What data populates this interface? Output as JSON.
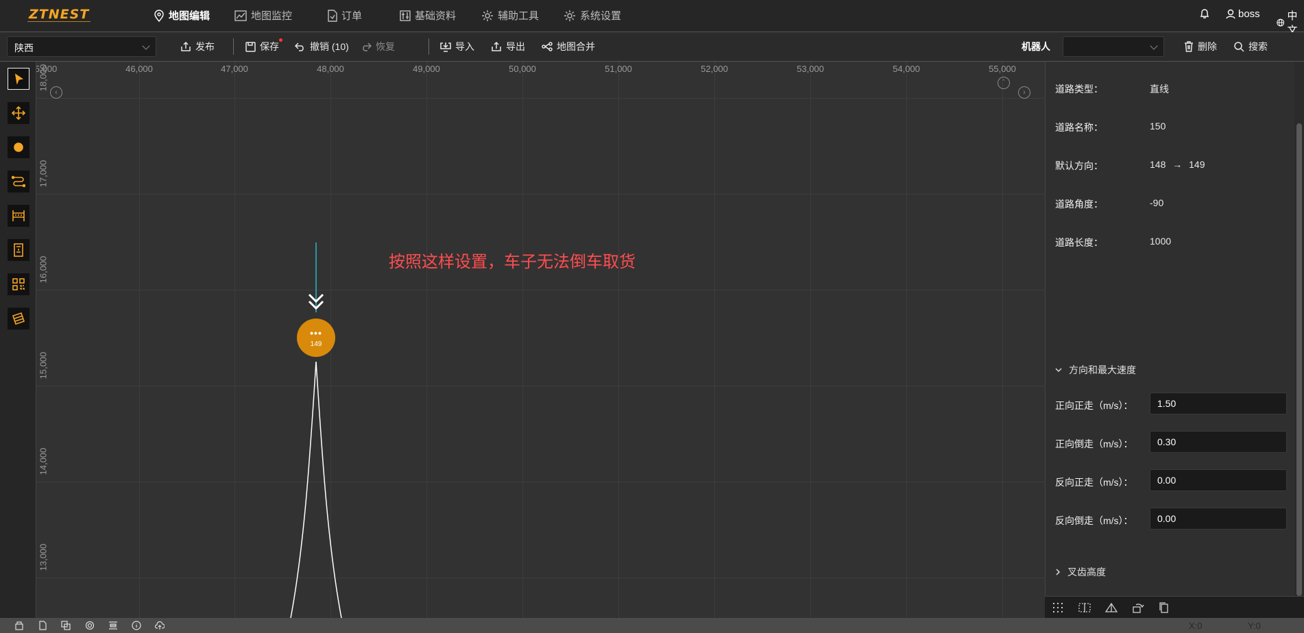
{
  "brand": {
    "logo_text": "ZTNEST",
    "accent": "#f5a524"
  },
  "nav": {
    "items": [
      {
        "label": "地图编辑",
        "icon": "map-pin-icon",
        "active": true
      },
      {
        "label": "地图监控",
        "icon": "chart-line-icon"
      },
      {
        "label": "订单",
        "icon": "document-icon"
      },
      {
        "label": "基础资料",
        "icon": "sliders-icon"
      },
      {
        "label": "辅助工具",
        "icon": "gear-icon"
      },
      {
        "label": "系统设置",
        "icon": "gear-icon"
      }
    ],
    "user": "boss",
    "lang": "中文"
  },
  "toolbar": {
    "region": "陕西",
    "publish": "发布",
    "save": "保存",
    "undo": "撤销 (10)",
    "redo": "恢复",
    "import": "导入",
    "export": "导出",
    "merge": "地图合并",
    "robot_label": "机器人",
    "robot_value": "",
    "delete": "删除",
    "search": "搜索"
  },
  "tools": [
    "select-tool-icon",
    "move-tool-icon",
    "point-tool-icon",
    "path-tool-icon",
    "shelf-tool-icon",
    "device-tool-icon",
    "qrcode-tool-icon",
    "area-tool-icon"
  ],
  "canvas": {
    "x_ticks": [
      "5,000",
      "46,000",
      "47,000",
      "48,000",
      "49,000",
      "50,000",
      "51,000",
      "52,000",
      "53,000",
      "54,000",
      "55,000"
    ],
    "y_ticks": [
      "18,000",
      "17,000",
      "16,000",
      "15,000",
      "14,000",
      "13,000"
    ],
    "annotation": "按照这样设置，车子无法倒车取货",
    "node": {
      "dots": "•••",
      "id": "149"
    }
  },
  "properties": {
    "road_type": {
      "label": "道路类型：",
      "value": "直线"
    },
    "road_name": {
      "label": "道路名称：",
      "value": "150"
    },
    "default_dir": {
      "label": "默认方向：",
      "from": "148",
      "arrow": "→",
      "to": "149"
    },
    "road_angle": {
      "label": "道路角度：",
      "value": "-90"
    },
    "road_length": {
      "label": "道路长度：",
      "value": "1000"
    }
  },
  "speed_section": {
    "title": "方向和最大速度",
    "forward_forward": {
      "label": "正向正走（m/s）：",
      "value": "1.50"
    },
    "forward_reverse": {
      "label": "正向倒走（m/s）：",
      "value": "0.30"
    },
    "reverse_forward": {
      "label": "反向正走（m/s）：",
      "value": "0.00"
    },
    "reverse_reverse": {
      "label": "反向倒走（m/s）：",
      "value": "0.00"
    }
  },
  "fork_section": {
    "title": "叉齿高度"
  },
  "status": {
    "x": "X:0",
    "y": "Y:0"
  }
}
